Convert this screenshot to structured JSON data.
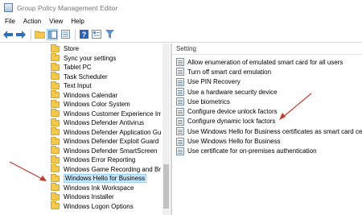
{
  "window": {
    "title": "Group Policy Management Editor"
  },
  "menu": [
    "File",
    "Action",
    "View",
    "Help"
  ],
  "toolbar": {
    "back_icon": "back-arrow-icon",
    "forward_icon": "forward-arrow-icon",
    "icons": [
      "folder-icon",
      "show-hide-tree-icon",
      "export-list-icon",
      "help-icon",
      "properties-icon",
      "filter-icon"
    ]
  },
  "tree": {
    "items": [
      "Store",
      "Sync your settings",
      "Tablet PC",
      "Task Scheduler",
      "Text Input",
      "Windows Calendar",
      "Windows Color System",
      "Windows Customer Experience Imp",
      "Windows Defender Antivirus",
      "Windows Defender Application Guz",
      "Windows Defender Exploit Guard",
      "Windows Defender SmartScreen",
      "Windows Error Reporting",
      "Windows Game Recording and Broa",
      "Windows Hello for Business",
      "Windows Ink Workspace",
      "Windows Installer",
      "Windows Logon Options"
    ],
    "selected_index": 14
  },
  "settings": {
    "column_header": "Setting",
    "items": [
      "Allow enumeration of emulated smart card for all users",
      "Turn off smart card emulation",
      "Use PIN Recovery",
      "Use a hardware security device",
      "Use biometrics",
      "Configure device unlock factors",
      "Configure dynamic lock factors",
      "Use Windows Hello for Business certificates as smart card ce...",
      "Use Windows Hello for Business",
      "Use certificate for on-premises authentication"
    ]
  },
  "colors": {
    "selection_bg": "#cce8ff",
    "selection_border": "#99d1ff",
    "annotation_arrow": "#c0392b",
    "folder": "#f2c94c"
  }
}
